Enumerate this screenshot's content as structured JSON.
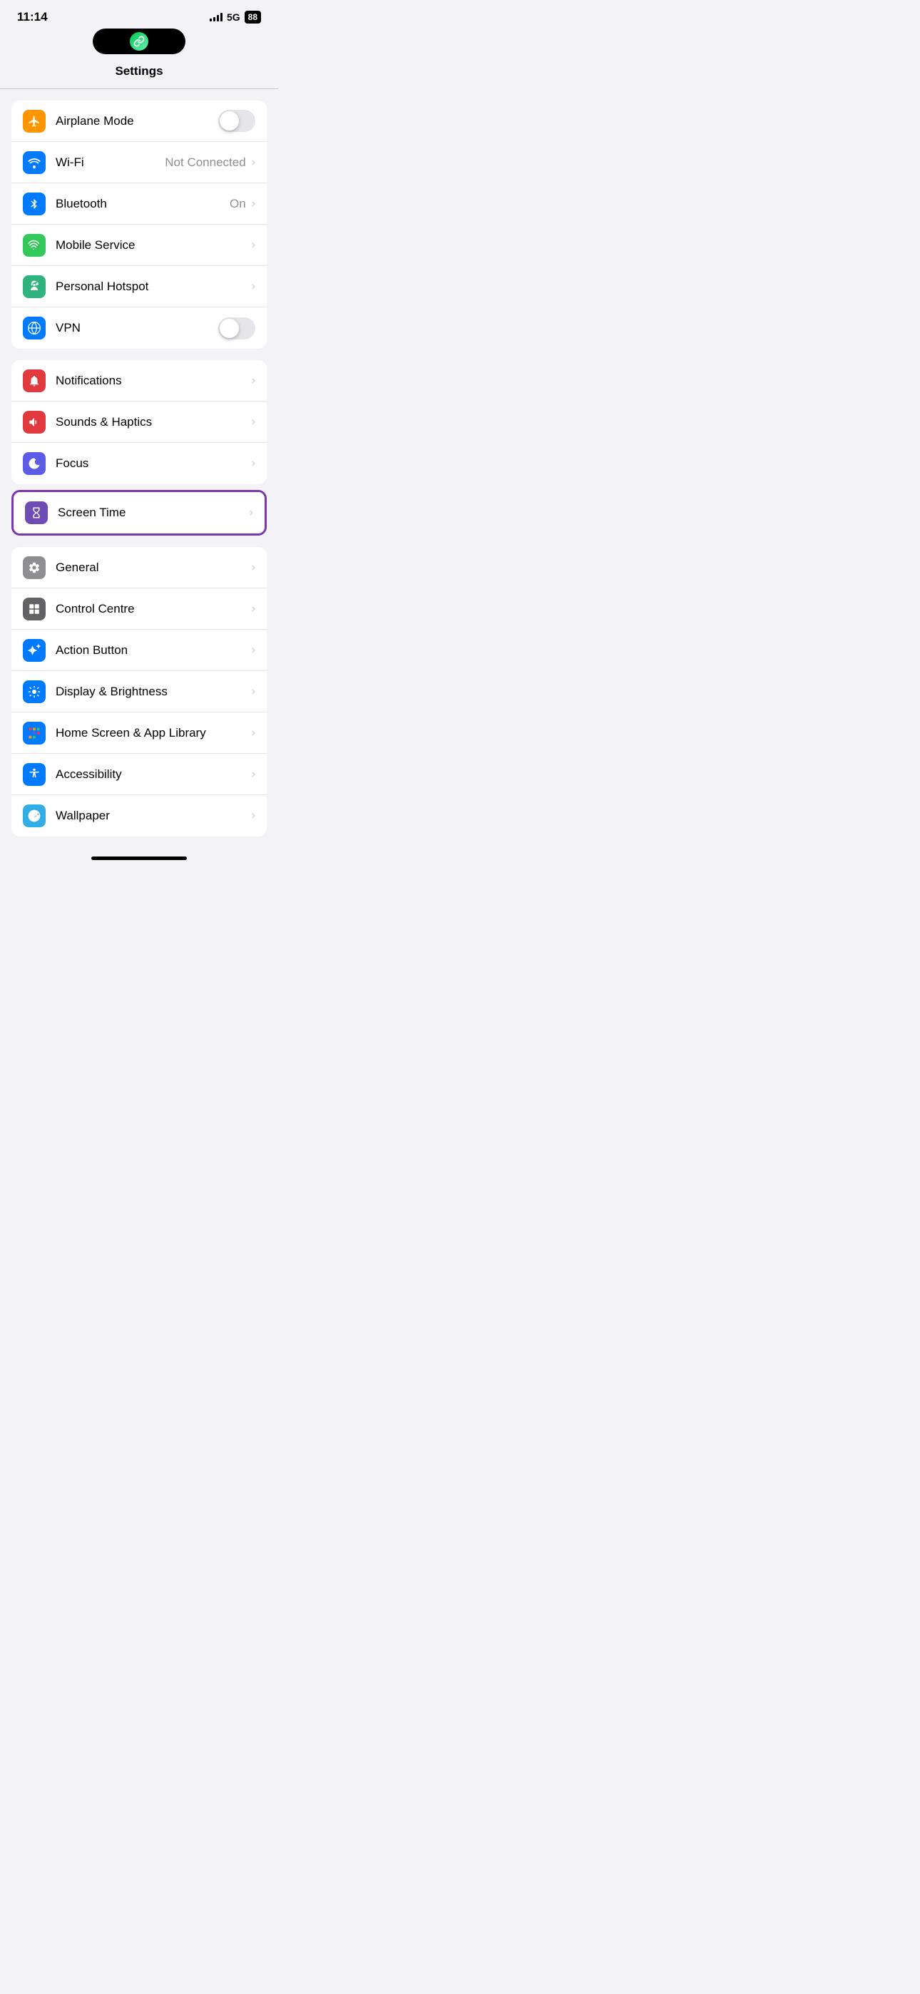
{
  "statusBar": {
    "time": "11:14",
    "network": "5G",
    "batteryLevel": "88",
    "signal": "strong"
  },
  "dynamicIsland": {
    "icon": "🔗"
  },
  "header": {
    "title": "Settings"
  },
  "groups": [
    {
      "id": "connectivity",
      "highlighted": false,
      "rows": [
        {
          "id": "airplane-mode",
          "label": "Airplane Mode",
          "iconBg": "bg-orange",
          "iconSymbol": "✈",
          "rightType": "toggle",
          "toggleOn": false,
          "value": "",
          "chevron": false
        },
        {
          "id": "wifi",
          "label": "Wi-Fi",
          "iconBg": "bg-blue",
          "iconSymbol": "wifi",
          "rightType": "text-chevron",
          "value": "Not Connected",
          "chevron": true
        },
        {
          "id": "bluetooth",
          "label": "Bluetooth",
          "iconBg": "bg-blue-dark",
          "iconSymbol": "bluetooth",
          "rightType": "text-chevron",
          "value": "On",
          "chevron": true
        },
        {
          "id": "mobile-service",
          "label": "Mobile Service",
          "iconBg": "bg-green",
          "iconSymbol": "signal",
          "rightType": "chevron",
          "value": "",
          "chevron": true
        },
        {
          "id": "personal-hotspot",
          "label": "Personal Hotspot",
          "iconBg": "bg-green-teal",
          "iconSymbol": "hotspot",
          "rightType": "chevron",
          "value": "",
          "chevron": true
        },
        {
          "id": "vpn",
          "label": "VPN",
          "iconBg": "bg-blue",
          "iconSymbol": "vpn",
          "rightType": "toggle",
          "toggleOn": false,
          "value": "",
          "chevron": false
        }
      ]
    },
    {
      "id": "notifications",
      "highlighted": false,
      "rows": [
        {
          "id": "notifications",
          "label": "Notifications",
          "iconBg": "bg-red-medium",
          "iconSymbol": "bell",
          "rightType": "chevron",
          "value": "",
          "chevron": true
        },
        {
          "id": "sounds-haptics",
          "label": "Sounds & Haptics",
          "iconBg": "bg-red-medium",
          "iconSymbol": "sound",
          "rightType": "chevron",
          "value": "",
          "chevron": true
        },
        {
          "id": "focus",
          "label": "Focus",
          "iconBg": "bg-purple",
          "iconSymbol": "moon",
          "rightType": "chevron",
          "value": "",
          "chevron": true
        },
        {
          "id": "screen-time",
          "label": "Screen Time",
          "iconBg": "bg-purple-dark",
          "iconSymbol": "hourglass",
          "rightType": "chevron",
          "value": "",
          "chevron": true
        }
      ]
    },
    {
      "id": "general-settings",
      "highlighted": false,
      "rows": [
        {
          "id": "general",
          "label": "General",
          "iconBg": "bg-gray",
          "iconSymbol": "gear",
          "rightType": "chevron",
          "value": "",
          "chevron": true
        },
        {
          "id": "control-centre",
          "label": "Control Centre",
          "iconBg": "bg-gray-dark",
          "iconSymbol": "sliders",
          "rightType": "chevron",
          "value": "",
          "chevron": true
        },
        {
          "id": "action-button",
          "label": "Action Button",
          "iconBg": "bg-blue",
          "iconSymbol": "action",
          "rightType": "chevron",
          "value": "",
          "chevron": true
        },
        {
          "id": "display-brightness",
          "label": "Display & Brightness",
          "iconBg": "bg-blue",
          "iconSymbol": "sun",
          "rightType": "chevron",
          "value": "",
          "chevron": true
        },
        {
          "id": "home-screen",
          "label": "Home Screen & App Library",
          "iconBg": "bg-blue",
          "iconSymbol": "homescreen",
          "rightType": "chevron",
          "value": "",
          "chevron": true
        },
        {
          "id": "accessibility",
          "label": "Accessibility",
          "iconBg": "bg-blue",
          "iconSymbol": "accessibility",
          "rightType": "chevron",
          "value": "",
          "chevron": true
        },
        {
          "id": "wallpaper",
          "label": "Wallpaper",
          "iconBg": "bg-cyan",
          "iconSymbol": "flower",
          "rightType": "chevron",
          "value": "",
          "chevron": true
        }
      ]
    }
  ],
  "highlightedRow": "screen-time",
  "labels": {
    "notConnected": "Not Connected",
    "on": "On"
  }
}
